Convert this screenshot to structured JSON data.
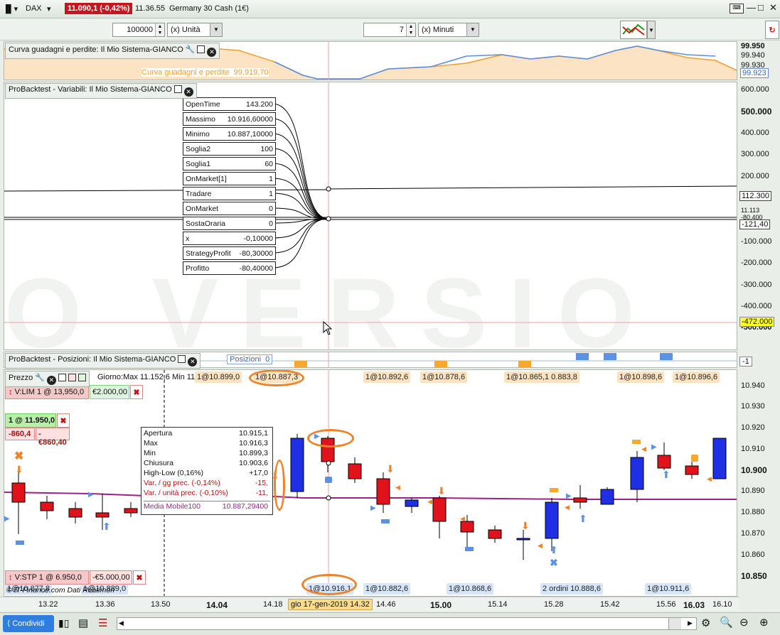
{
  "titlebar": {
    "instrument": "DAX",
    "quote": "11.090,1 (-0,42%)",
    "time": "11.36.55",
    "name": "Germany 30 Cash (1€)"
  },
  "controls": {
    "qty": "100000",
    "qty_unit": "(x) Unità",
    "period": "7",
    "period_unit": "(x) Minuti"
  },
  "equity": {
    "title": "Curva guadagni e perdite: Il Mio Sistema-GIANCO",
    "legend_label": "Curva guadagni e perdite",
    "legend_value": "99.919,70",
    "axis": [
      "99.950",
      "99.940",
      "99.930"
    ],
    "current": "99.923"
  },
  "vars": {
    "title": "ProBacktest - Variabili: Il Mio Sistema-GIANCO",
    "items": [
      {
        "name": "OpenTime",
        "value": "143.200"
      },
      {
        "name": "Massimo",
        "value": "10.916,60000"
      },
      {
        "name": "Minimo",
        "value": "10.887,10000"
      },
      {
        "name": "Soglia2",
        "value": "100"
      },
      {
        "name": "Soglia1",
        "value": "60"
      },
      {
        "name": "OnMarket[1]",
        "value": "1"
      },
      {
        "name": "Tradare",
        "value": "1"
      },
      {
        "name": "OnMarket",
        "value": "0"
      },
      {
        "name": "SostaOraria",
        "value": "0"
      },
      {
        "name": "x",
        "value": "-0,10000"
      },
      {
        "name": "StrategyProfit",
        "value": "-80,30000"
      },
      {
        "name": "Profitto",
        "value": "-80,40000"
      }
    ],
    "axis": [
      "600.000",
      "500.000",
      "400.000",
      "300.000",
      "200.000",
      "100.000",
      "-100.000",
      "-200.000",
      "-300.000",
      "-400.000",
      "-500.000"
    ],
    "badges": {
      "b1": "112.300",
      "b2": "11.113",
      "b3": "-80,400",
      "b4": "-121,40",
      "b5": "-472.000"
    }
  },
  "positions": {
    "title": "ProBacktest - Posizioni: Il Mio Sistema-GIANCO",
    "label": "Posizioni",
    "value": "0",
    "badge": "-1"
  },
  "price": {
    "title": "Prezzo",
    "dayinfo": "Giorno:Max 11.152,6 Min 11.08",
    "axis": [
      "10.940",
      "10.930",
      "10.920",
      "10.910",
      "10.900",
      "10.890",
      "10.880",
      "10.870",
      "10.860",
      "10.850"
    ],
    "lim_order": "V:LIM 1 @ 13,950,0",
    "lim_amount": "€2.000,00",
    "pos_label": "1 @ 11.950,0",
    "pos_pts": "-860,4",
    "pos_eur": "-€860,40",
    "stp_order": "V:STP 1 @ 6.950,0",
    "stp_amount": "-€5.000,00",
    "credit": "© IT-Finance.com  Dati Reatimon",
    "top_tags": [
      "1@10.899,0",
      "1@10.887,3",
      "1@10.892,6",
      "1@10.878,6",
      "1@10.865,1 0.883,8",
      "1@10.898,6",
      "1@10.896,6"
    ],
    "bottom_tags": [
      "1@10.877,8",
      "1@10.889,0",
      "1@10.916,1",
      "1@10.882,6",
      "1@10.868,6",
      "2 ordini 10.888,6",
      "1@10.911,6"
    ],
    "ma_label": "Media Mobile100",
    "ma_value": "10.887,29400"
  },
  "info": {
    "rows": [
      {
        "k": "Apertura",
        "v": "10.915,1"
      },
      {
        "k": "Max",
        "v": "10.916,3"
      },
      {
        "k": "Min",
        "v": "10.899,3"
      },
      {
        "k": "Chiusura",
        "v": "10.903,6"
      },
      {
        "k": "High-Low (0,16%)",
        "v": "+17,0"
      },
      {
        "k": "Var. / gg prec. (-0,14%)",
        "v": "-15,"
      },
      {
        "k": "Var. / unità prec. (-0,10%)",
        "v": "-11,"
      }
    ]
  },
  "xaxis": {
    "labels": [
      "13.22",
      "13.36",
      "13.50",
      "14.04",
      "14.18",
      "14.46",
      "15.00",
      "15.14",
      "15.28",
      "15.42",
      "15.56",
      "16.03",
      "16.10"
    ],
    "cursor": "gio 17-gen-2019 14.32"
  },
  "bottom": {
    "share": "Condividi"
  },
  "candles": [
    {
      "o": 10.894,
      "h": 10.9,
      "l": 10.87,
      "c": 10.885
    },
    {
      "o": 10.885,
      "h": 10.888,
      "l": 10.877,
      "c": 10.881
    },
    {
      "o": 10.882,
      "h": 10.885,
      "l": 10.875,
      "c": 10.878
    },
    {
      "o": 10.88,
      "h": 10.889,
      "l": 10.872,
      "c": 10.878
    },
    {
      "o": 10.882,
      "h": 10.885,
      "l": 10.878,
      "c": 10.88
    },
    {
      "o": 10.892,
      "h": 10.898,
      "l": 10.888,
      "c": 10.887
    },
    {
      "o": 10.89,
      "h": 10.917,
      "l": 10.887,
      "c": 10.915
    },
    {
      "o": 10.915,
      "h": 10.916,
      "l": 10.899,
      "c": 10.904
    },
    {
      "o": 10.903,
      "h": 10.906,
      "l": 10.894,
      "c": 10.896
    },
    {
      "o": 10.896,
      "h": 10.899,
      "l": 10.88,
      "c": 10.884
    },
    {
      "o": 10.883,
      "h": 10.887,
      "l": 10.88,
      "c": 10.886
    },
    {
      "o": 10.887,
      "h": 10.888,
      "l": 10.868,
      "c": 10.876
    },
    {
      "o": 10.876,
      "h": 10.879,
      "l": 10.862,
      "c": 10.871
    },
    {
      "o": 10.872,
      "h": 10.874,
      "l": 10.866,
      "c": 10.868
    },
    {
      "o": 10.868,
      "h": 10.872,
      "l": 10.858,
      "c": 10.868
    },
    {
      "o": 10.868,
      "h": 10.887,
      "l": 10.862,
      "c": 10.885
    },
    {
      "o": 10.887,
      "h": 10.893,
      "l": 10.882,
      "c": 10.885
    },
    {
      "o": 10.884,
      "h": 10.892,
      "l": 10.884,
      "c": 10.891
    },
    {
      "o": 10.891,
      "h": 10.909,
      "l": 10.885,
      "c": 10.906
    },
    {
      "o": 10.907,
      "h": 10.913,
      "l": 10.9,
      "c": 10.901
    },
    {
      "o": 10.902,
      "h": 10.904,
      "l": 10.896,
      "c": 10.898
    },
    {
      "o": 10.896,
      "h": 10.915,
      "l": 10.896,
      "c": 10.915
    }
  ],
  "colors": {
    "up": "#1e2fe6",
    "down": "#e0121c",
    "ma": "#a0208a",
    "equity_fill": "#fbe3c3",
    "equity_line": "#f0a030",
    "equity_blue": "#5c8ee0",
    "accent": "#f0832a"
  }
}
